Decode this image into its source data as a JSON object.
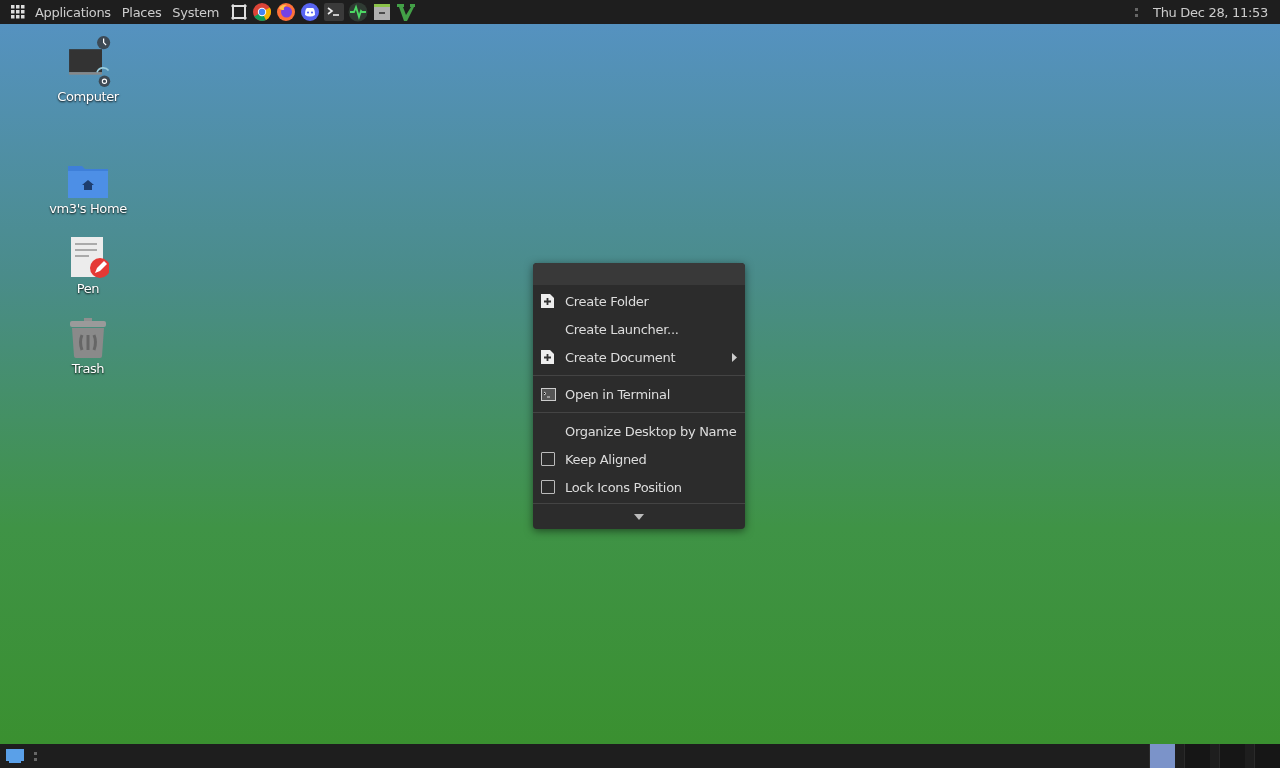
{
  "top_panel": {
    "menus": [
      {
        "label": "Applications"
      },
      {
        "label": "Places"
      },
      {
        "label": "System"
      }
    ],
    "launchers": [
      {
        "kind": "screenshot"
      },
      {
        "kind": "chrome"
      },
      {
        "kind": "firefox"
      },
      {
        "kind": "discord"
      },
      {
        "kind": "terminal"
      },
      {
        "kind": "monitor"
      },
      {
        "kind": "files"
      },
      {
        "kind": "vim"
      }
    ],
    "clock": "Thu Dec 28, 11:53"
  },
  "desktop_icons": [
    {
      "kind": "computer",
      "label": "Computer"
    },
    {
      "kind": "home",
      "label": "vm3's Home"
    },
    {
      "kind": "document",
      "label": "Pen"
    },
    {
      "kind": "trash",
      "label": "Trash"
    }
  ],
  "context_menu": {
    "items": [
      {
        "kind": "folder",
        "label": "Create Folder"
      },
      {
        "kind": "plain",
        "label": "Create Launcher..."
      },
      {
        "kind": "document",
        "label": "Create Document",
        "submenu": true
      },
      {
        "kind": "separator"
      },
      {
        "kind": "terminal",
        "label": "Open in Terminal"
      },
      {
        "kind": "separator"
      },
      {
        "kind": "plain",
        "label": "Organize Desktop by Name"
      },
      {
        "kind": "check",
        "label": "Keep Aligned",
        "checked": false
      },
      {
        "kind": "check",
        "label": "Lock Icons Position",
        "checked": false
      }
    ]
  },
  "bottom_panel": {
    "workspaces": [
      {
        "selected": true
      },
      {
        "selected": false
      },
      {
        "selected": false
      },
      {
        "selected": false
      }
    ]
  }
}
